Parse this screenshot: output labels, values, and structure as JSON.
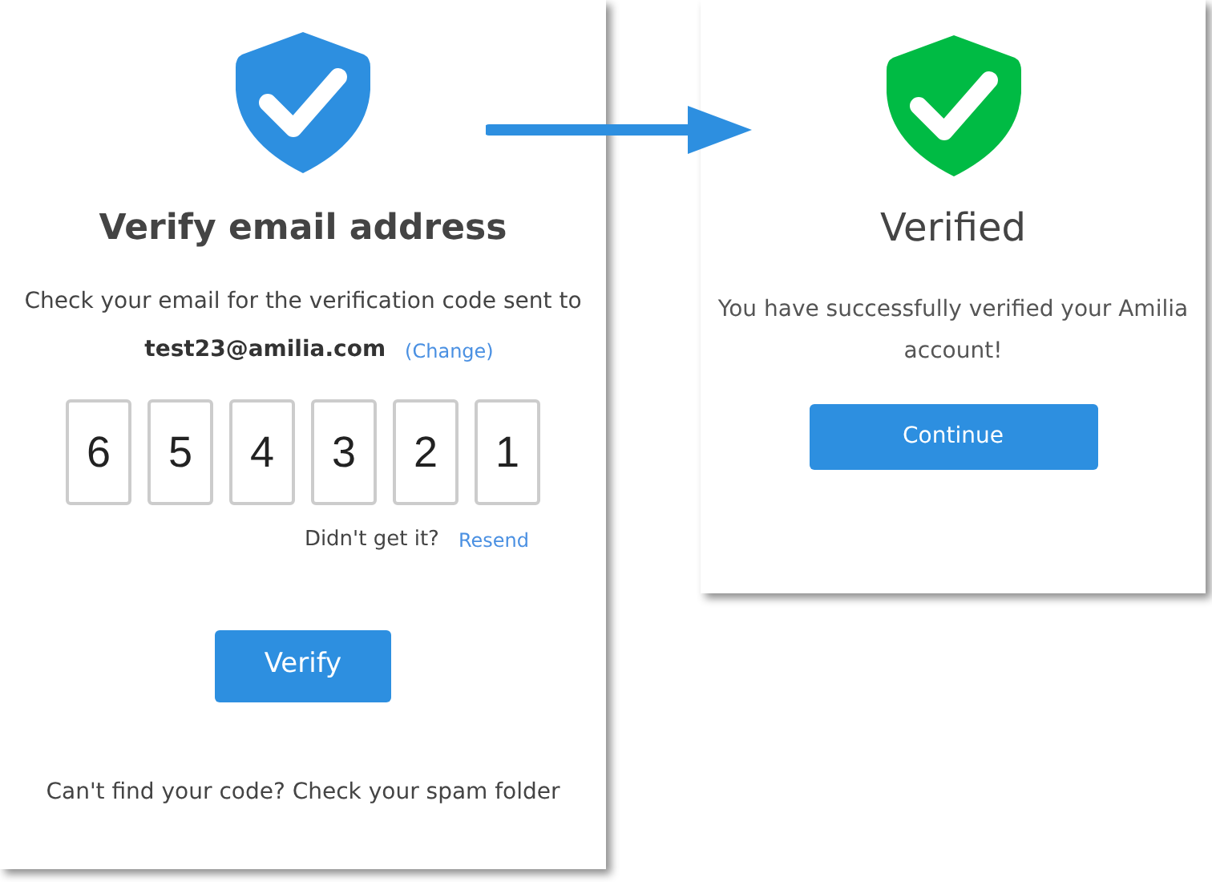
{
  "panels": [
    {
      "kind": "verify",
      "color": "#2d8fe0",
      "title": "Verify email address",
      "instructions": "Check your email for the verification code sent to",
      "email": "test23@amilia.com",
      "change_link": "(Change)",
      "code_digits": [
        "6",
        "5",
        "4",
        "3",
        "2",
        "1"
      ],
      "resend_prompt": "Didn't get it?",
      "resend_link": "Resend",
      "button": "Verify",
      "footer": "Can't find your code? Check your spam folder"
    },
    {
      "kind": "verified",
      "color": "#00bb44",
      "title": "Verified",
      "message": "You have successfully verified your Amilia account!",
      "button": "Continue"
    }
  ]
}
